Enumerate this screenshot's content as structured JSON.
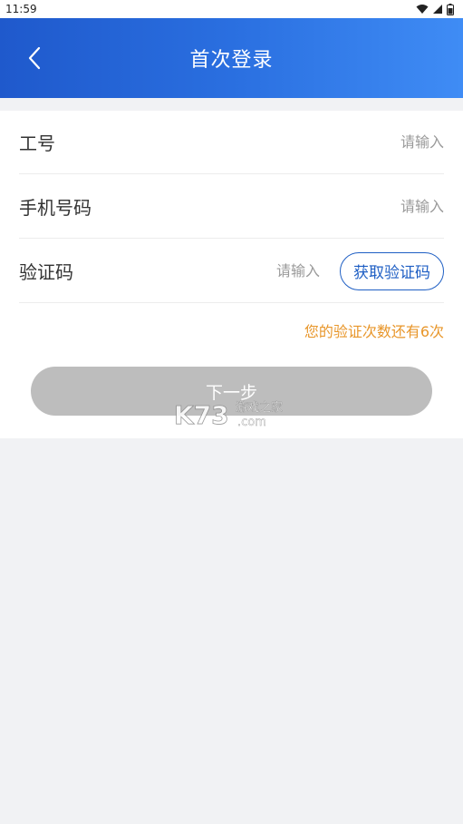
{
  "status_bar": {
    "time": "11:59"
  },
  "nav": {
    "title": "首次登录"
  },
  "form": {
    "employee_id": {
      "label": "工号",
      "placeholder": "请输入",
      "value": ""
    },
    "phone": {
      "label": "手机号码",
      "placeholder": "请输入",
      "value": ""
    },
    "code": {
      "label": "验证码",
      "placeholder": "请输入",
      "value": "",
      "button_label": "获取验证码"
    },
    "attempts_text": "您的验证次数还有6次",
    "next_label": "下一步"
  },
  "watermark": {
    "brand": "K73",
    "cn_text": "游戏之家",
    "suffix": ".com"
  },
  "colors": {
    "nav_gradient_start": "#1f59cc",
    "nav_gradient_end": "#3f8cf5",
    "accent_blue": "#1f5fc4",
    "warning_orange": "#e8962a",
    "disabled_button": "#bdbdbd",
    "background": "#f1f2f4"
  },
  "icons": {
    "back": "chevron-left-icon",
    "wifi": "wifi-icon",
    "signal": "signal-icon",
    "battery": "battery-icon"
  }
}
